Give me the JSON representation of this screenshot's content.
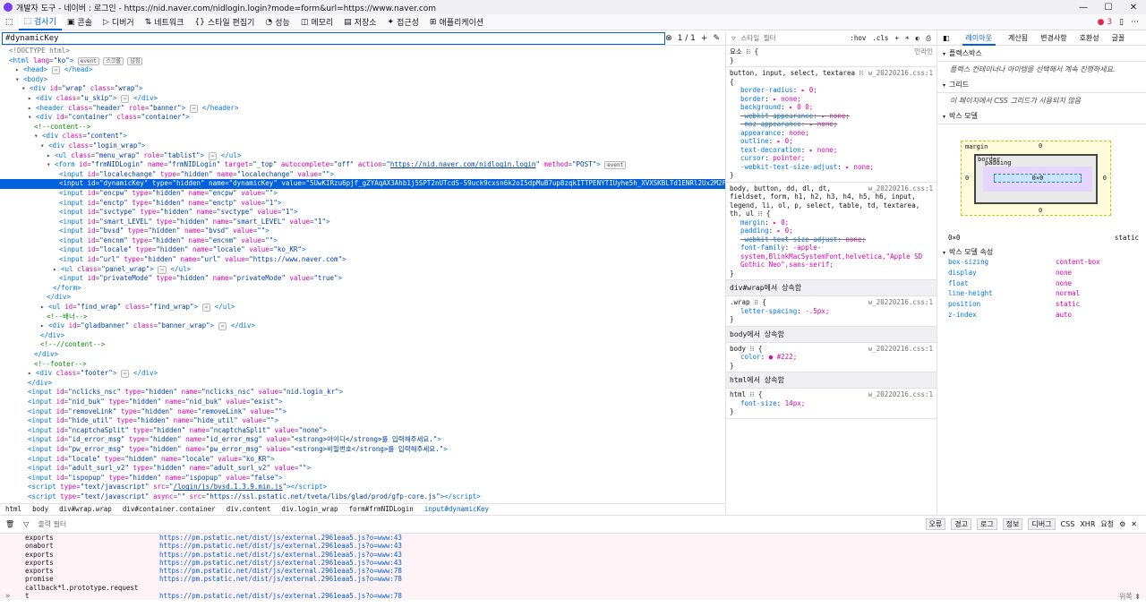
{
  "title_bar": {
    "title": "개발자 도구 - 네이버 : 로그인 - https://nid.naver.com/nidlogin.login?mode=form&url=https://www.naver.com",
    "minimize": "—",
    "maximize": "☐",
    "close": "✕"
  },
  "toolbar": {
    "tabs": [
      {
        "icon": "⬚",
        "label": "검사기"
      },
      {
        "icon": "▣",
        "label": "콘솔"
      },
      {
        "icon": "▷",
        "label": "디버거"
      },
      {
        "icon": "⇅",
        "label": "네트워크"
      },
      {
        "icon": "{}",
        "label": "스타일 편집기"
      },
      {
        "icon": "◔",
        "label": "성능"
      },
      {
        "icon": "◫",
        "label": "메모리"
      },
      {
        "icon": "▤",
        "label": "저장소"
      },
      {
        "icon": "✦",
        "label": "접근성"
      },
      {
        "icon": "⊞",
        "label": "애플리케이션"
      }
    ],
    "error_count": "3",
    "menu_glyph": "⋯"
  },
  "search": {
    "value": "#dynamicKey",
    "count": "1 / 1"
  },
  "inspector_lines": [
    {
      "i": 0,
      "html": "<span class='tw'>&lt;!DOCTYPE html&gt;</span>"
    },
    {
      "i": 0,
      "html": "<span class='tag'>&lt;html</span> <span class='an'>lang</span>=<span class='av'>\"ko\"</span><span class='tag'>&gt;</span> <span class='badge'>event</span> <span class='badge'>스크롤</span> <span class='badge'>넘침</span>"
    },
    {
      "i": 1,
      "html": "▸ <span class='tag'>&lt;head&gt;</span> <span class='badge'>⋯</span> <span class='tag'>&lt;/head&gt;</span>"
    },
    {
      "i": 1,
      "html": "▾ <span class='tag'>&lt;body&gt;</span>"
    },
    {
      "i": 2,
      "html": "▾ <span class='tag'>&lt;div</span> <span class='an'>id</span>=<span class='av'>\"wrap\"</span> <span class='an'>class</span>=<span class='av'>\"wrap\"</span><span class='tag'>&gt;</span>"
    },
    {
      "i": 3,
      "html": "▸ <span class='tag'>&lt;div</span> <span class='an'>class</span>=<span class='av'>\"u_skip\"</span><span class='tag'>&gt;</span> <span class='badge'>⋯</span> <span class='tag'>&lt;/div&gt;</span>"
    },
    {
      "i": 3,
      "html": "▸ <span class='tag'>&lt;header</span> <span class='an'>class</span>=<span class='av'>\"header\"</span> <span class='an'>role</span>=<span class='av'>\"banner\"</span><span class='tag'>&gt;</span> <span class='badge'>⋯</span> <span class='tag'>&lt;/header&gt;</span>"
    },
    {
      "i": 3,
      "html": "▾ <span class='tag'>&lt;div</span> <span class='an'>id</span>=<span class='av'>\"container\"</span> <span class='an'>class</span>=<span class='av'>\"container\"</span><span class='tag'>&gt;</span>"
    },
    {
      "i": 4,
      "html": "<span class='cm'>&lt;!--content--&gt;</span>"
    },
    {
      "i": 4,
      "html": "▾ <span class='tag'>&lt;div</span> <span class='an'>class</span>=<span class='av'>\"content\"</span><span class='tag'>&gt;</span>"
    },
    {
      "i": 5,
      "html": "▾ <span class='tag'>&lt;div</span> <span class='an'>class</span>=<span class='av'>\"login_wrap\"</span><span class='tag'>&gt;</span>"
    },
    {
      "i": 6,
      "html": "▸ <span class='tag'>&lt;ul</span> <span class='an'>class</span>=<span class='av'>\"menu_wrap\"</span> <span class='an'>role</span>=<span class='av'>\"tablist\"</span><span class='tag'>&gt;</span> <span class='badge'>⋯</span> <span class='tag'>&lt;/ul&gt;</span>"
    },
    {
      "i": 6,
      "html": "▾ <span class='tag'>&lt;form</span> <span class='an'>id</span>=<span class='av'>\"frmNIDLogin\"</span> <span class='an'>name</span>=<span class='av'>\"frmNIDLogin\"</span> <span class='an'>target</span>=<span class='av'>\"_top\"</span> <span class='an'>autocomplete</span>=<span class='av'>\"off\"</span> <span class='an'>action</span>=<span class='av'>\"<u>https://nid.naver.com/nidlogin.login</u>\"</span> <span class='an'>method</span>=<span class='av'>\"POST\"</span><span class='tag'>&gt;</span> <span class='badge'>event</span>"
    },
    {
      "i": 8,
      "html": "<span class='tag'>&lt;input</span> <span class='an'>id</span>=<span class='av'>\"localechange\"</span> <span class='an'>type</span>=<span class='av'>\"hidden\"</span> <span class='an'>name</span>=<span class='av'>\"localechange\"</span> <span class='an'>value</span>=<span class='av'>\"\"</span><span class='tag'>&gt;</span>"
    },
    {
      "i": 8,
      "hl": true,
      "html": "<span class='tag'>&lt;input</span> <span class='an'>id</span>=<span class='av'>\"dynamicKey\"</span> <span class='an'>type</span>=<span class='av'>\"hidden\"</span> <span class='an'>name</span>=<span class='av'>\"dynamicKey\"</span> <span class='an'>value</span>=<span class='av'>\"5UwKIRzu6pjf_gZYAqAX3Ahb1j5SPT2nUTcdS-S9uck9cxsn6k2oI5dpMuB7up8zqkITTPENYTIUyhe5h_XVXSKBLTd1ENRl2Ux2M2FeKco\"</span><span class='tag'>&gt;</span>"
    },
    {
      "i": 8,
      "html": "<span class='tag'>&lt;input</span> <span class='an'>id</span>=<span class='av'>\"encpw\"</span> <span class='an'>type</span>=<span class='av'>\"hidden\"</span> <span class='an'>name</span>=<span class='av'>\"encpw\"</span> <span class='an'>value</span>=<span class='av'>\"\"</span><span class='tag'>&gt;</span>"
    },
    {
      "i": 8,
      "html": "<span class='tag'>&lt;input</span> <span class='an'>id</span>=<span class='av'>\"enctp\"</span> <span class='an'>type</span>=<span class='av'>\"hidden\"</span> <span class='an'>name</span>=<span class='av'>\"enctp\"</span> <span class='an'>value</span>=<span class='av'>\"1\"</span><span class='tag'>&gt;</span>"
    },
    {
      "i": 8,
      "html": "<span class='tag'>&lt;input</span> <span class='an'>id</span>=<span class='av'>\"svctype\"</span> <span class='an'>type</span>=<span class='av'>\"hidden\"</span> <span class='an'>name</span>=<span class='av'>\"svctype\"</span> <span class='an'>value</span>=<span class='av'>\"1\"</span><span class='tag'>&gt;</span>"
    },
    {
      "i": 8,
      "html": "<span class='tag'>&lt;input</span> <span class='an'>id</span>=<span class='av'>\"smart_LEVEL\"</span> <span class='an'>type</span>=<span class='av'>\"hidden\"</span> <span class='an'>name</span>=<span class='av'>\"smart_LEVEL\"</span> <span class='an'>value</span>=<span class='av'>\"1\"</span><span class='tag'>&gt;</span>"
    },
    {
      "i": 8,
      "html": "<span class='tag'>&lt;input</span> <span class='an'>id</span>=<span class='av'>\"bvsd\"</span> <span class='an'>type</span>=<span class='av'>\"hidden\"</span> <span class='an'>name</span>=<span class='av'>\"bvsd\"</span> <span class='an'>value</span>=<span class='av'>\"\"</span><span class='tag'>&gt;</span>"
    },
    {
      "i": 8,
      "html": "<span class='tag'>&lt;input</span> <span class='an'>id</span>=<span class='av'>\"encnm\"</span> <span class='an'>type</span>=<span class='av'>\"hidden\"</span> <span class='an'>name</span>=<span class='av'>\"encnm\"</span> <span class='an'>value</span>=<span class='av'>\"\"</span><span class='tag'>&gt;</span>"
    },
    {
      "i": 8,
      "html": "<span class='tag'>&lt;input</span> <span class='an'>id</span>=<span class='av'>\"locale\"</span> <span class='an'>type</span>=<span class='av'>\"hidden\"</span> <span class='an'>name</span>=<span class='av'>\"locale\"</span> <span class='an'>value</span>=<span class='av'>\"ko_KR\"</span><span class='tag'>&gt;</span>"
    },
    {
      "i": 8,
      "html": "<span class='tag'>&lt;input</span> <span class='an'>id</span>=<span class='av'>\"url\"</span> <span class='an'>type</span>=<span class='av'>\"hidden\"</span> <span class='an'>name</span>=<span class='av'>\"url\"</span> <span class='an'>value</span>=<span class='av'>\"https://www.naver.com\"</span><span class='tag'>&gt;</span>"
    },
    {
      "i": 7,
      "html": "▸ <span class='tag'>&lt;ul</span> <span class='an'>class</span>=<span class='av'>\"panel_wrap\"</span><span class='tag'>&gt;</span> <span class='badge'>⋯</span> <span class='tag'>&lt;/ul&gt;</span>"
    },
    {
      "i": 8,
      "html": "<span class='tag'>&lt;input</span> <span class='an'>id</span>=<span class='av'>\"privateMode\"</span> <span class='an'>type</span>=<span class='av'>\"hidden\"</span> <span class='an'>name</span>=<span class='av'>\"privateMode\"</span> <span class='an'>value</span>=<span class='av'>\"true\"</span><span class='tag'>&gt;</span>"
    },
    {
      "i": 7,
      "html": "<span class='tag'>&lt;/form&gt;</span>"
    },
    {
      "i": 6,
      "html": "<span class='tag'>&lt;/div&gt;</span>"
    },
    {
      "i": 5,
      "html": "▸ <span class='tag'>&lt;ul</span> <span class='an'>id</span>=<span class='av'>\"find_wrap\"</span> <span class='an'>class</span>=<span class='av'>\"find_wrap\"</span><span class='tag'>&gt;</span> <span class='badge'>⋯</span> <span class='tag'>&lt;/ul&gt;</span>"
    },
    {
      "i": 6,
      "html": "<span class='cm'>&lt;!--배너--&gt;</span>"
    },
    {
      "i": 5,
      "html": "▸ <span class='tag'>&lt;div</span> <span class='an'>id</span>=<span class='av'>\"gladbanner\"</span> <span class='an'>class</span>=<span class='av'>\"banner_wrap\"</span><span class='tag'>&gt;</span> <span class='badge'>⋯</span> <span class='tag'>&lt;/div&gt;</span>"
    },
    {
      "i": 5,
      "html": "<span class='tag'>&lt;/div&gt;</span>"
    },
    {
      "i": 5,
      "html": "<span class='cm'>&lt;!--//content--&gt;</span>"
    },
    {
      "i": 4,
      "html": "<span class='tag'>&lt;/div&gt;</span>"
    },
    {
      "i": 4,
      "html": "<span class='cm'>&lt;!--footer--&gt;</span>"
    },
    {
      "i": 3,
      "html": "▸ <span class='tag'>&lt;div</span> <span class='an'>class</span>=<span class='av'>\"footer\"</span><span class='tag'>&gt;</span> <span class='badge'>⋯</span> <span class='tag'>&lt;/div&gt;</span>"
    },
    {
      "i": 3,
      "html": "<span class='tag'>&lt;/div&gt;</span>"
    },
    {
      "i": 3,
      "html": "<span class='tag'>&lt;input</span> <span class='an'>id</span>=<span class='av'>\"nclicks_nsc\"</span> <span class='an'>type</span>=<span class='av'>\"hidden\"</span> <span class='an'>name</span>=<span class='av'>\"nclicks_nsc\"</span> <span class='an'>value</span>=<span class='av'>\"nid.login_kr\"</span><span class='tag'>&gt;</span>"
    },
    {
      "i": 3,
      "html": "<span class='tag'>&lt;input</span> <span class='an'>id</span>=<span class='av'>\"nid_buk\"</span> <span class='an'>type</span>=<span class='av'>\"hidden\"</span> <span class='an'>name</span>=<span class='av'>\"nid_buk\"</span> <span class='an'>value</span>=<span class='av'>\"exist\"</span><span class='tag'>&gt;</span>"
    },
    {
      "i": 3,
      "html": "<span class='tag'>&lt;input</span> <span class='an'>id</span>=<span class='av'>\"removeLink\"</span> <span class='an'>type</span>=<span class='av'>\"hidden\"</span> <span class='an'>name</span>=<span class='av'>\"removeLink\"</span> <span class='an'>value</span>=<span class='av'>\"\"</span><span class='tag'>&gt;</span>"
    },
    {
      "i": 3,
      "html": "<span class='tag'>&lt;input</span> <span class='an'>id</span>=<span class='av'>\"hide_util\"</span> <span class='an'>type</span>=<span class='av'>\"hidden\"</span> <span class='an'>name</span>=<span class='av'>\"hide_util\"</span> <span class='an'>value</span>=<span class='av'>\"\"</span><span class='tag'>&gt;</span>"
    },
    {
      "i": 3,
      "html": "<span class='tag'>&lt;input</span> <span class='an'>id</span>=<span class='av'>\"ncaptchaSplit\"</span> <span class='an'>type</span>=<span class='av'>\"hidden\"</span> <span class='an'>name</span>=<span class='av'>\"ncaptchaSplit\"</span> <span class='an'>value</span>=<span class='av'>\"none\"</span><span class='tag'>&gt;</span>"
    },
    {
      "i": 3,
      "html": "<span class='tag'>&lt;input</span> <span class='an'>id</span>=<span class='av'>\"id_error_msg\"</span> <span class='an'>type</span>=<span class='av'>\"hidden\"</span> <span class='an'>name</span>=<span class='av'>\"id_error_msg\"</span> <span class='an'>value</span>=<span class='av'>\"&lt;strong&gt;아이디&lt;/strong&gt;를 입력해주세요.\"</span><span class='tag'>&gt;</span>"
    },
    {
      "i": 3,
      "html": "<span class='tag'>&lt;input</span> <span class='an'>id</span>=<span class='av'>\"pw_error_msg\"</span> <span class='an'>type</span>=<span class='av'>\"hidden\"</span> <span class='an'>name</span>=<span class='av'>\"pw_error_msg\"</span> <span class='an'>value</span>=<span class='av'>\"&lt;strong&gt;비밀번호&lt;/strong&gt;를 입력해주세요.\"</span><span class='tag'>&gt;</span>"
    },
    {
      "i": 3,
      "html": "<span class='tag'>&lt;input</span> <span class='an'>id</span>=<span class='av'>\"locale\"</span> <span class='an'>type</span>=<span class='av'>\"hidden\"</span> <span class='an'>name</span>=<span class='av'>\"locale\"</span> <span class='an'>value</span>=<span class='av'>\"ko_KR\"</span><span class='tag'>&gt;</span>"
    },
    {
      "i": 3,
      "html": "<span class='tag'>&lt;input</span> <span class='an'>id</span>=<span class='av'>\"adult_surl_v2\"</span> <span class='an'>type</span>=<span class='av'>\"hidden\"</span> <span class='an'>name</span>=<span class='av'>\"adult_surl_v2\"</span> <span class='an'>value</span>=<span class='av'>\"\"</span><span class='tag'>&gt;</span>"
    },
    {
      "i": 3,
      "html": "<span class='tag'>&lt;input</span> <span class='an'>id</span>=<span class='av'>\"ispopup\"</span> <span class='an'>type</span>=<span class='av'>\"hidden\"</span> <span class='an'>name</span>=<span class='av'>\"ispopup\"</span> <span class='an'>value</span>=<span class='av'>\"false\"</span><span class='tag'>&gt;</span>"
    },
    {
      "i": 3,
      "html": "<span class='tag'>&lt;script</span> <span class='an'>type</span>=<span class='av'>\"text/javascript\"</span> <span class='an'>src</span>=<span class='av'>\"<u>/login/js/bvsd.1.3.9.min.js</u>\"</span><span class='tag'>&gt;&lt;/script&gt;</span>"
    },
    {
      "i": 3,
      "html": "<span class='tag'>&lt;script</span> <span class='an'>type</span>=<span class='av'>\"text/javascript\"</span> <span class='an'>async</span>=<span class='av'>\"\"</span> <span class='an'>src</span>=<span class='av'>\"https://ssl.pstatic.net/tveta/libs/glad/prod/gfp-core.js\"</span><span class='tag'>&gt;&lt;/script&gt;</span>"
    }
  ],
  "breadcrumbs": [
    "html",
    "body",
    "div#wrap.wrap",
    "div#container.container",
    "div.content",
    "div.login_wrap",
    "form#frmNIDLogin",
    "input#dynamicKey"
  ],
  "rules_panel": {
    "filter_placeholder": "스타일 필터",
    "hov": ":hov",
    "cls": ".cls",
    "plus": "+",
    "element_label": "요소 ⁝⁝ {",
    "inline_label": "인라인",
    "rules": [
      {
        "selector": "button, input, select, textarea ⁝⁝ {",
        "src": "w_20220216.css:1",
        "props": [
          [
            "border-radius",
            "▸ 0;",
            false
          ],
          [
            "border",
            "▸ none;",
            false
          ],
          [
            "background",
            "▸ 0 0;",
            false
          ],
          [
            "-webkit-appearance",
            "▸ none;",
            true
          ],
          [
            "-moz-appearance",
            "▸ none;",
            true
          ],
          [
            "appearance",
            "none;",
            false
          ],
          [
            "outline",
            "▸ 0;",
            false
          ],
          [
            "text-decoration",
            "▸ none;",
            false
          ],
          [
            "cursor",
            "pointer;",
            false
          ],
          [
            "-webkit-text-size-adjust",
            "▸ none;",
            false
          ]
        ]
      },
      {
        "selector": "body, button, dd, dl, dt, fieldset, form, h1, h2, h3, h4, h5, h6, input, legend, li, ol, p, select, table, td, textarea, th, ul ⁝⁝ {",
        "src": "w_20220216.css:1",
        "props": [
          [
            "margin",
            "▸ 0;",
            false
          ],
          [
            "padding",
            "▸ 0;",
            false
          ],
          [
            "-webkit-text-size-adjust",
            "none;",
            true
          ],
          [
            "font-family",
            "-apple-system,BlinkMacSystemFont,helvetica,\"Apple SD Gothic Neo\",sans-serif;",
            false
          ]
        ]
      }
    ],
    "inherited": [
      {
        "title": "div#wrap에서 상속함",
        "selector": ".wrap ⁝⁝ {",
        "src": "w_20220216.css:1",
        "props": [
          [
            "letter-spacing",
            "-.5px;"
          ]
        ]
      },
      {
        "title": "body에서 상속함",
        "selector": "body ⁝⁝ {",
        "src": "w_20220216.css:1",
        "props": [
          [
            "color",
            "● #222;"
          ]
        ]
      },
      {
        "title": "html에서 상속함",
        "selector": "html ⁝⁝ {",
        "src": "w_20220216.css:1",
        "props": [
          [
            "font-size",
            "14px;"
          ]
        ]
      }
    ]
  },
  "layout_panel": {
    "tabs": [
      "레이아웃",
      "계산됨",
      "변경사항",
      "호환성",
      "글꼴"
    ],
    "flexbox_title": "플렉스박스",
    "flexbox_note": "플렉스 컨테이너나 아이템을 선택해서 계속 진행하세요.",
    "grid_title": "그리드",
    "grid_note": "이 페이지에서 CSS 그리드가 사용되지 않음",
    "boxmodel_title": "박스 모델",
    "boxmodel": {
      "margin": "margin",
      "border": "border",
      "padding": "padding",
      "content": "0×0",
      "zero": "0",
      "size": "0×0",
      "position": "static"
    },
    "props_title": "박스 모델 속성",
    "props": [
      [
        "box-sizing",
        "content-box"
      ],
      [
        "display",
        "none"
      ],
      [
        "float",
        "none"
      ],
      [
        "line-height",
        "normal"
      ],
      [
        "position",
        "static"
      ],
      [
        "z-index",
        "auto"
      ]
    ]
  },
  "console": {
    "filter_placeholder": "출력 필터",
    "levels": [
      "오류",
      "경고",
      "로그",
      "정보",
      "디버그"
    ],
    "extra": [
      "CSS",
      "XHR",
      "요청"
    ],
    "logs": [
      [
        "exports",
        "https://pm.pstatic.net/dist/js/external.2961eaa5.js?o=www:43"
      ],
      [
        "onabort",
        "https://pm.pstatic.net/dist/js/external.2961eaa5.js?o=www:43"
      ],
      [
        "exports",
        "https://pm.pstatic.net/dist/js/external.2961eaa5.js?o=www:43"
      ],
      [
        "exports",
        "https://pm.pstatic.net/dist/js/external.2961eaa5.js?o=www:43"
      ],
      [
        "exports",
        "https://pm.pstatic.net/dist/js/external.2961eaa5.js?o=www:78"
      ],
      [
        "promise callback*l.prototype.request",
        "https://pm.pstatic.net/dist/js/external.2961eaa5.js?o=www:78"
      ],
      [
        "t",
        "https://pm.pstatic.net/dist/js/external.2961eaa5.js?o=www:78"
      ]
    ],
    "prompt": "»",
    "right_label": "위쪽 ⬍"
  }
}
